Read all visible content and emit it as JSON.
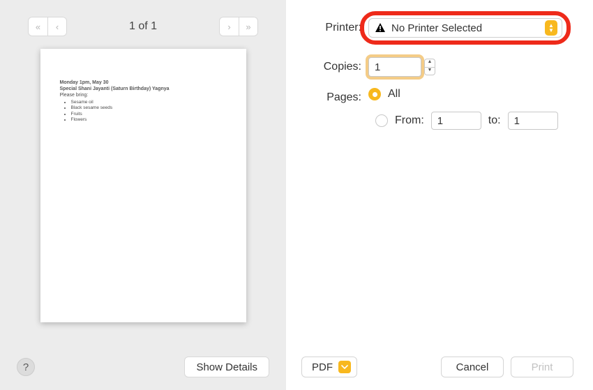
{
  "preview": {
    "page_indicator": "1 of 1",
    "document": {
      "line1": "Monday 1pm, May 30",
      "line2": "Special Shani Jayanti (Saturn Birthday) Yagnya",
      "bring_label": "Please bring:",
      "items": [
        "Sesame oil",
        "Black sesame seeds",
        "Fruits",
        "Flowers"
      ]
    }
  },
  "footer_left": {
    "help_label": "?",
    "show_details_label": "Show Details"
  },
  "settings": {
    "printer_label": "Printer:",
    "printer_value": "No Printer Selected",
    "copies_label": "Copies:",
    "copies_value": "1",
    "pages_label": "Pages:",
    "pages_all_label": "All",
    "pages_from_label": "From:",
    "pages_to_label": "to:",
    "pages_from_value": "1",
    "pages_to_value": "1",
    "pages_mode": "all"
  },
  "footer_right": {
    "pdf_label": "PDF",
    "cancel_label": "Cancel",
    "print_label": "Print"
  }
}
